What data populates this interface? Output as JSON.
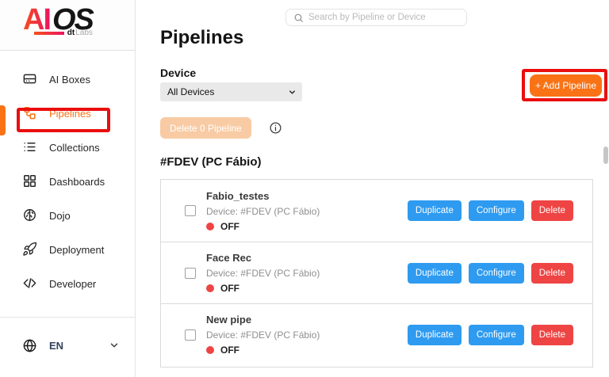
{
  "logo": {
    "ai": "AI",
    "os": "OS",
    "dt": "dt",
    "labs": "Labs"
  },
  "sidebar": {
    "items": [
      {
        "label": "AI Boxes"
      },
      {
        "label": "Pipelines",
        "active": true
      },
      {
        "label": "Collections"
      },
      {
        "label": "Dashboards"
      },
      {
        "label": "Dojo"
      },
      {
        "label": "Deployment"
      },
      {
        "label": "Developer"
      }
    ],
    "language": "EN"
  },
  "header": {
    "search_placeholder": "Search by Pipeline or Device"
  },
  "page": {
    "title": "Pipelines",
    "device_label": "Device",
    "device_filter_value": "All Devices",
    "add_button": "+ Add Pipeline",
    "bulk_delete_button": "Delete 0 Pipeline",
    "group_title": "#FDEV (PC Fábio)"
  },
  "buttons": {
    "duplicate": "Duplicate",
    "configure": "Configure",
    "delete": "Delete"
  },
  "pipelines": [
    {
      "name": "Fabio_testes",
      "device": "Device: #FDEV (PC Fábio)",
      "status": "OFF"
    },
    {
      "name": "Face Rec",
      "device": "Device: #FDEV (PC Fábio)",
      "status": "OFF"
    },
    {
      "name": "New pipe",
      "device": "Device: #FDEV (PC Fábio)",
      "status": "OFF"
    }
  ],
  "colors": {
    "accent_orange": "#F97316",
    "primary_blue": "#2E9BF0",
    "danger_red": "#EF4444",
    "annotation_red": "#EA0E0E",
    "disabled_peach": "#F8CBA4",
    "status_off_dot": "#EF4444"
  }
}
